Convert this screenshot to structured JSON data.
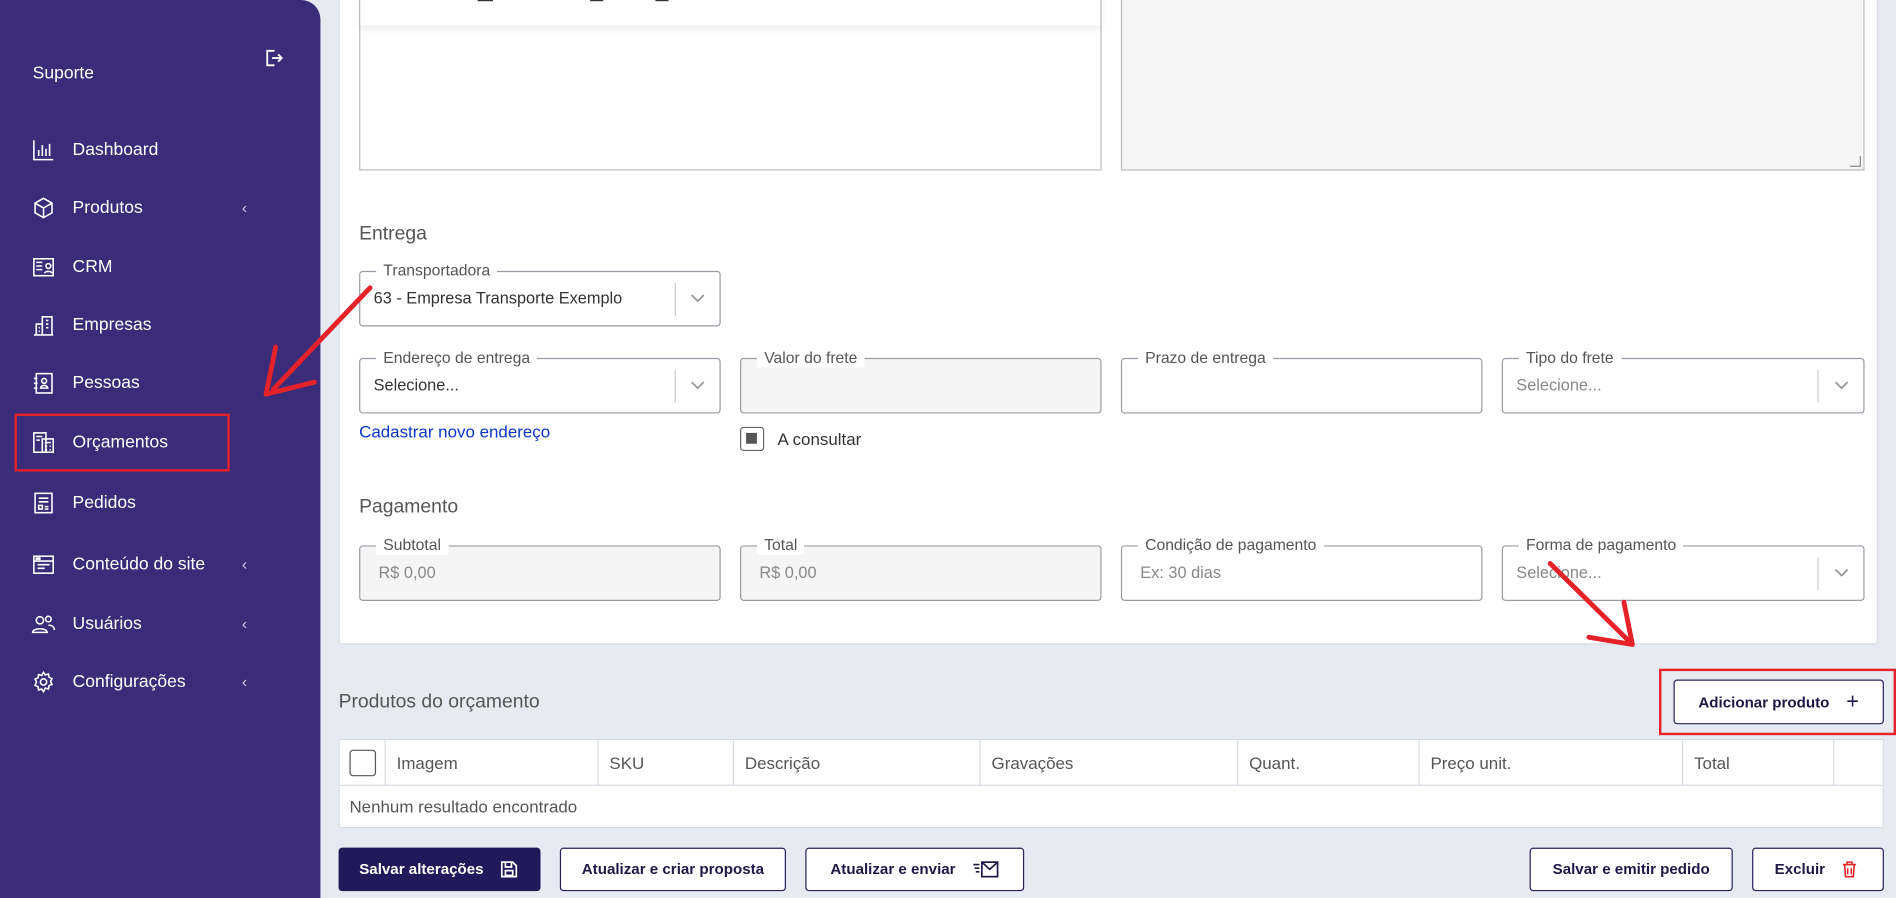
{
  "sidebar": {
    "brand": "Suporte",
    "items": [
      {
        "label": "Dashboard"
      },
      {
        "label": "Produtos"
      },
      {
        "label": "CRM"
      },
      {
        "label": "Empresas"
      },
      {
        "label": "Pessoas"
      },
      {
        "label": "Orçamentos"
      },
      {
        "label": "Pedidos"
      },
      {
        "label": "Conteúdo do site"
      },
      {
        "label": "Usuários"
      },
      {
        "label": "Configurações"
      }
    ]
  },
  "entrega": {
    "title": "Entrega",
    "transportadora": {
      "label": "Transportadora",
      "value": "63 - Empresa Transporte Exemplo"
    },
    "endereco": {
      "label": "Endereço de entrega",
      "value": "Selecione..."
    },
    "valor_frete": {
      "label": "Valor do frete",
      "value": ""
    },
    "prazo": {
      "label": "Prazo de entrega",
      "value": ""
    },
    "tipo_frete": {
      "label": "Tipo do frete",
      "placeholder": "Selecione..."
    },
    "novo_endereco_link": "Cadastrar novo endereço",
    "a_consultar": "A consultar"
  },
  "pagamento": {
    "title": "Pagamento",
    "subtotal": {
      "label": "Subtotal",
      "value": "R$ 0,00"
    },
    "total": {
      "label": "Total",
      "value": "R$ 0,00"
    },
    "condicao": {
      "label": "Condição de pagamento",
      "placeholder": "Ex: 30 dias"
    },
    "forma": {
      "label": "Forma de pagamento",
      "placeholder": "Selecione..."
    }
  },
  "produtos": {
    "title": "Produtos do orçamento",
    "add_button": "Adicionar produto",
    "columns": [
      "Imagem",
      "SKU",
      "Descrição",
      "Gravações",
      "Quant.",
      "Preço unit.",
      "Total"
    ],
    "empty_message": "Nenhum resultado encontrado"
  },
  "actions": {
    "save": "Salvar alterações",
    "update_proposal": "Atualizar e criar proposta",
    "update_send": "Atualizar e enviar",
    "save_order": "Salvar e emitir pedido",
    "delete": "Excluir"
  },
  "colors": {
    "sidebar_bg": "#3a2c78",
    "primary_button": "#22195a",
    "annotation_red": "#e5212a",
    "link": "#0b36c8"
  }
}
